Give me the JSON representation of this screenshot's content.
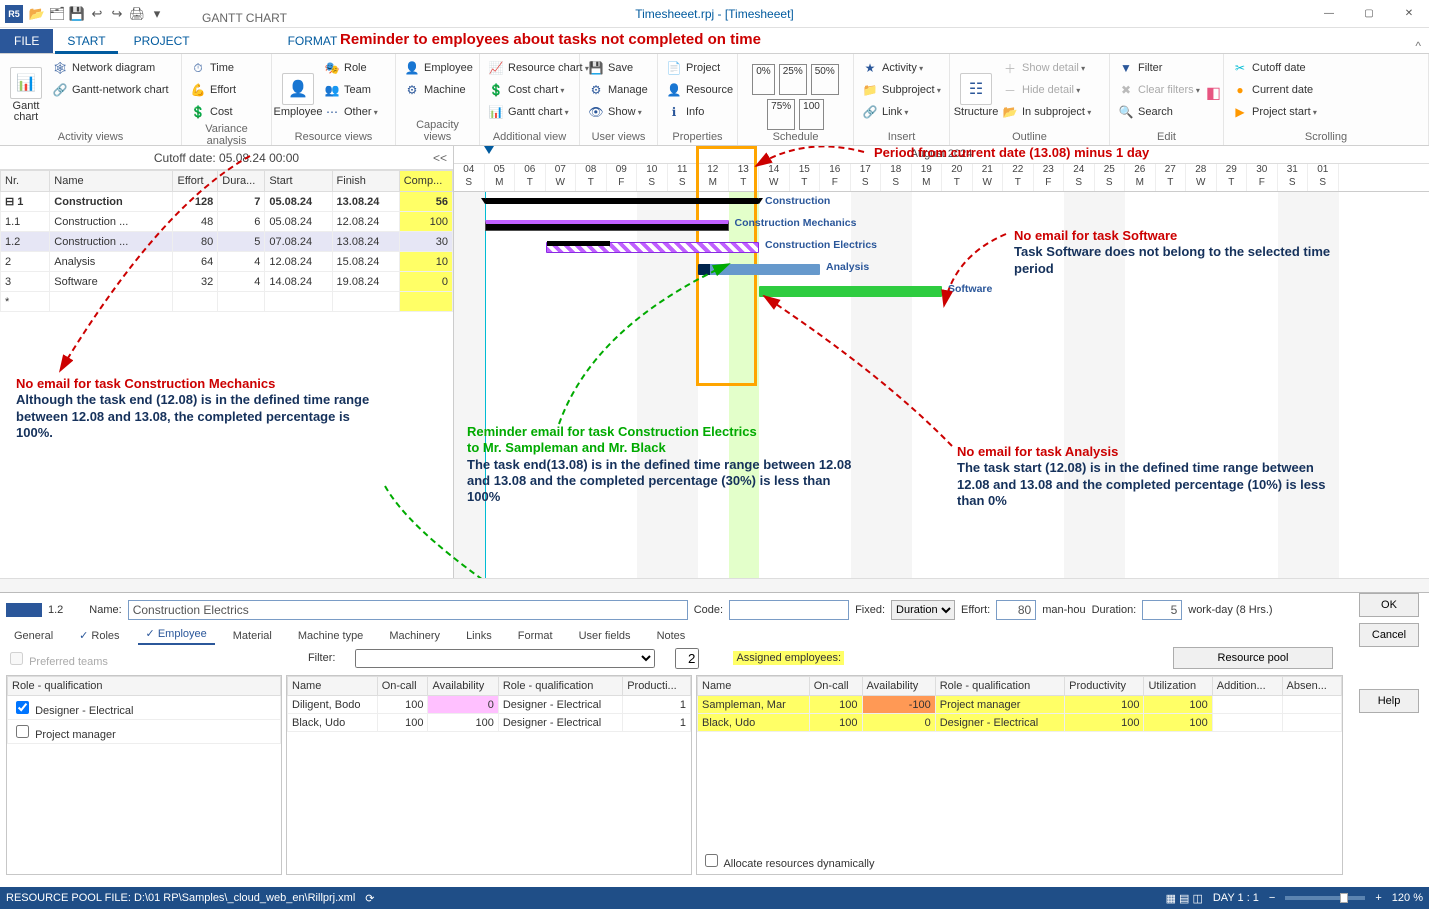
{
  "window": {
    "title": "Timesheeet.rpj - [Timesheeet]",
    "app_icon_text": "R5"
  },
  "qat": [
    "📂",
    "🗂",
    "💾",
    "↩",
    "↪",
    "🖨",
    "▾"
  ],
  "tabs": {
    "file": "FILE",
    "start": "START",
    "project": "PROJECT",
    "gantt": "GANTT CHART",
    "format": "FORMAT"
  },
  "headline": "Reminder to employees about tasks not completed on time",
  "ribbon": {
    "activity": {
      "label": "Activity views",
      "gantt": "Gantt chart",
      "network": "Network diagram",
      "gn": "Gantt-network chart"
    },
    "variance": {
      "label": "Variance analysis",
      "time": "Time",
      "effort": "Effort",
      "cost": "Cost"
    },
    "resource": {
      "label": "Resource views",
      "employee": "Employee",
      "role": "Role",
      "team": "Team",
      "machine": "Machine",
      "other": "Other"
    },
    "capacity": {
      "label": "Capacity views",
      "emp": "Employee",
      "cost": "Cost chart",
      "gantt": "Gantt chart"
    },
    "additional": {
      "label": "Additional view",
      "rc": "Resource chart"
    },
    "user": {
      "label": "User views",
      "save": "Save",
      "manage": "Manage",
      "show": "Show"
    },
    "props": {
      "label": "Properties",
      "project": "Project",
      "resource": "Resource",
      "info": "Info"
    },
    "schedule": {
      "label": "Schedule"
    },
    "insert": {
      "label": "Insert",
      "activity": "Activity",
      "subproject": "Subproject",
      "link": "Link"
    },
    "outline": {
      "label": "Outline",
      "structure": "Structure",
      "showdetail": "Show detail",
      "hidedetail": "Hide detail",
      "insub": "In subproject"
    },
    "edit": {
      "label": "Edit",
      "filter": "Filter",
      "clear": "Clear filters",
      "search": "Search"
    },
    "scroll": {
      "label": "Scrolling",
      "cutoff": "Cutoff date",
      "current": "Current date",
      "pstart": "Project start"
    }
  },
  "cutoff_label": "Cutoff date: 05.08.24 00:00",
  "cutoff_cc": "<<",
  "grid": {
    "headers": {
      "nr": "Nr.",
      "name": "Name",
      "effort": "Effort",
      "dur": "Dura...",
      "start": "Start",
      "finish": "Finish",
      "comp": "Comp..."
    },
    "rows": [
      {
        "nr": "1",
        "name": "Construction",
        "effort": "128",
        "dur": "7",
        "start": "05.08.24",
        "finish": "13.08.24",
        "comp": "56",
        "sum": true,
        "exp": "⊟"
      },
      {
        "nr": "1.1",
        "name": "Construction ...",
        "effort": "48",
        "dur": "6",
        "start": "05.08.24",
        "finish": "12.08.24",
        "comp": "100"
      },
      {
        "nr": "1.2",
        "name": "Construction ...",
        "effort": "80",
        "dur": "5",
        "start": "07.08.24",
        "finish": "13.08.24",
        "comp": "30",
        "sel": true
      },
      {
        "nr": "2",
        "name": "Analysis",
        "effort": "64",
        "dur": "4",
        "start": "12.08.24",
        "finish": "15.08.24",
        "comp": "10"
      },
      {
        "nr": "3",
        "name": "Software",
        "effort": "32",
        "dur": "4",
        "start": "14.08.24",
        "finish": "19.08.24",
        "comp": "0"
      },
      {
        "nr": "*",
        "name": "",
        "effort": "",
        "dur": "",
        "start": "",
        "finish": "",
        "comp": ""
      }
    ]
  },
  "timeline": {
    "month": "August 2024",
    "days": [
      "04",
      "05",
      "06",
      "07",
      "08",
      "09",
      "10",
      "11",
      "12",
      "13",
      "14",
      "15",
      "16",
      "17",
      "18",
      "19",
      "20",
      "21",
      "22",
      "23",
      "24",
      "25",
      "26",
      "27",
      "28",
      "29",
      "30",
      "31",
      "01"
    ],
    "dows": [
      "S",
      "M",
      "T",
      "W",
      "T",
      "F",
      "S",
      "S",
      "M",
      "T",
      "W",
      "T",
      "F",
      "S",
      "S",
      "M",
      "T",
      "W",
      "T",
      "F",
      "S",
      "S",
      "M",
      "T",
      "W",
      "T",
      "F",
      "S",
      "S"
    ],
    "labels": {
      "construction": "Construction",
      "cmech": "Construction Mechanics",
      "celec": "Construction Electrics",
      "analysis": "Analysis",
      "software": "Software"
    }
  },
  "annotations": {
    "period": "Period from current date (13.08) minus 1 day",
    "nosoft_t": "No email for task Software",
    "nosoft_b": "Task Software does not belong to the selected time period",
    "nomech_t": "No email for task Construction Mechanics",
    "nomech_b": "Although the task end (12.08) is in the defined time range between 12.08 and 13.08, the completed percentage is 100%.",
    "reminder_t": "Reminder email for task Construction Electrics",
    "reminder_t2": "to Mr. Sampleman and Mr. Black",
    "reminder_b": "The task end(13.08) is in the defined time range between 12.08 and 13.08 and the completed percentage (30%) is less than 100%",
    "noanal_t": "No email for task Analysis",
    "noanal_b": "The task start (12.08) is in the defined time range between 12.08 and 13.08 and the completed percentage (10%) is less than 0%"
  },
  "detail": {
    "nr": "1.2",
    "name_lbl": "Name:",
    "name_val": "Construction Electrics",
    "code_lbl": "Code:",
    "fixed_lbl": "Fixed:",
    "fixed_val": "Duration",
    "effort_lbl": "Effort:",
    "effort_val": "80",
    "effort_u": "man-hou",
    "dur_lbl": "Duration:",
    "dur_val": "5",
    "dur_u": "work-day (8 Hrs.)",
    "tabs": {
      "general": "General",
      "roles": "Roles",
      "employee": "Employee",
      "material": "Material",
      "machinetype": "Machine type",
      "machinery": "Machinery",
      "links": "Links",
      "format": "Format",
      "userfields": "User fields",
      "notes": "Notes"
    },
    "pref_teams": "Preferred teams",
    "filter": "Filter:",
    "filter_n": "2",
    "assigned_lbl": "Assigned employees:",
    "pool_btn": "Resource pool",
    "rq_hdr": "Role - qualification",
    "rq1": "Designer - Electrical",
    "rq2": "Project manager",
    "mid_hdr": {
      "name": "Name",
      "oncall": "On-call",
      "avail": "Availability",
      "rq": "Role - qualification",
      "prod": "Producti..."
    },
    "mid_rows": [
      {
        "name": "Diligent, Bodo",
        "oncall": "100",
        "avail": "0",
        "rq": "Designer - Electrical",
        "prod": "1"
      },
      {
        "name": "Black, Udo",
        "oncall": "100",
        "avail": "100",
        "rq": "Designer - Electrical",
        "prod": "1"
      }
    ],
    "right_hdr": {
      "name": "Name",
      "oncall": "On-call",
      "avail": "Availability",
      "rq": "Role - qualification",
      "prod": "Productivity",
      "util": "Utilization",
      "add": "Addition...",
      "abs": "Absen..."
    },
    "right_rows": [
      {
        "name": "Sampleman, Mar",
        "oncall": "100",
        "avail": "-100",
        "rq": "Project manager",
        "prod": "100",
        "util": "100"
      },
      {
        "name": "Black, Udo",
        "oncall": "100",
        "avail": "0",
        "rq": "Designer - Electrical",
        "prod": "100",
        "util": "100"
      }
    ],
    "alloc": "Allocate resources dynamically",
    "ok": "OK",
    "cancel": "Cancel",
    "help": "Help"
  },
  "status": {
    "pool": "RESOURCE POOL FILE: D:\\01 RP\\Samples\\_cloud_web_en\\Rillprj.xml",
    "day": "DAY 1 : 1",
    "zoom": "120 %"
  }
}
